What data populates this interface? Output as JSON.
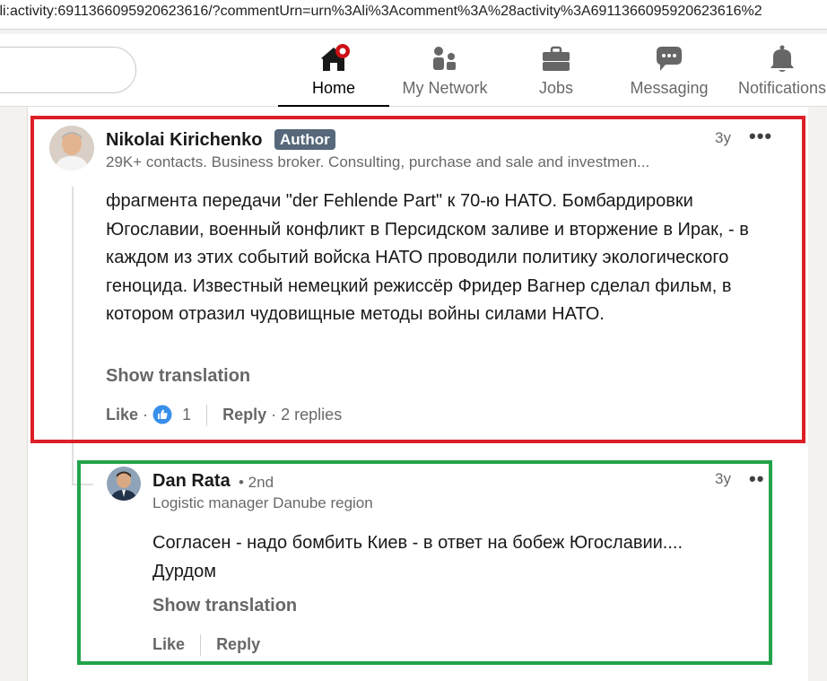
{
  "browser": {
    "url": ":li:activity:6911366095920623616/?commentUrn=urn%3Ali%3Acomment%3A%28activity%3A6911366095920623616%2"
  },
  "nav": {
    "items": [
      {
        "label": "Home",
        "icon": "home-icon",
        "active": true
      },
      {
        "label": "My Network",
        "icon": "network-icon"
      },
      {
        "label": "Jobs",
        "icon": "briefcase-icon"
      },
      {
        "label": "Messaging",
        "icon": "message-icon"
      },
      {
        "label": "Notifications",
        "icon": "bell-icon"
      }
    ]
  },
  "comment": {
    "author": "Nikolai Kirichenko",
    "badge": "Author",
    "headline": "29K+ contacts. Business broker. Consulting, purchase and sale and investmen...",
    "time": "3y",
    "more": "•••",
    "text": " фрагмента передачи \"der Fehlende Part\" к 70-ю НАТО. Бомбардировки Югославии, военный конфликт в Персидском заливе и вторжение в Ирак, - в каждом из этих событий войска НАТО проводили политику экологического геноцида. Известный немецкий режиссёр Фридер Вагнер сделал фильм, в котором отразил чудовищные методы войны силами НАТО.",
    "show_translation": "Show translation",
    "like_label": "Like",
    "like_count": "1",
    "reply_label": "Reply",
    "replies": "2 replies"
  },
  "reply": {
    "author": "Dan Rata",
    "degree": "• 2nd",
    "headline": "Logistic manager Danube region",
    "time": "3y",
    "more": "••",
    "text": "Согласен - надо бомбить Киев - в ответ на бобеж Югославии.... Дурдом",
    "show_translation": "Show translation",
    "like_label": "Like",
    "reply_label": "Reply"
  },
  "colors": {
    "highlight_red": "#dc1f26",
    "highlight_green": "#23a34a",
    "notification_dot": "#cc1016",
    "like_blue": "#378fe9",
    "badge_gray": "#56687a"
  }
}
